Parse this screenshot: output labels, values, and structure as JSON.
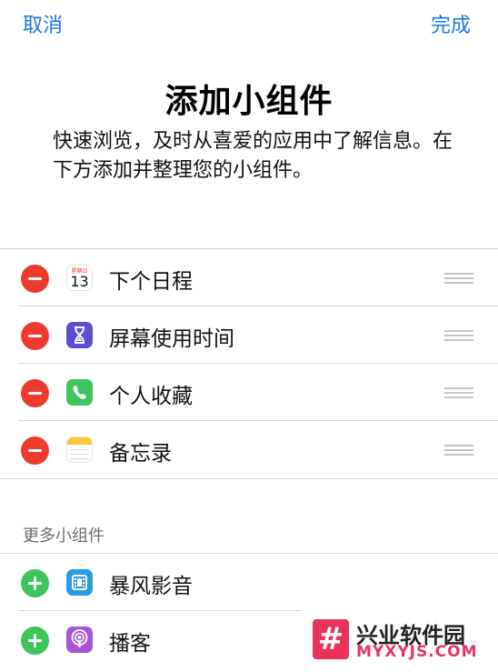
{
  "nav": {
    "cancel_label": "取消",
    "done_label": "完成"
  },
  "header": {
    "title": "添加小组件",
    "subtitle": "快速浏览，及时从喜爱的应用中了解信息。在下方添加并整理您的小组件。"
  },
  "active_widgets": [
    {
      "label": "下个日程",
      "icon": "calendar-icon",
      "calendar_weekday": "星期日",
      "calendar_day": "13"
    },
    {
      "label": "屏幕使用时间",
      "icon": "hourglass-icon"
    },
    {
      "label": "个人收藏",
      "icon": "phone-icon"
    },
    {
      "label": "备忘录",
      "icon": "notes-icon"
    }
  ],
  "more_section": {
    "header": "更多小组件",
    "items": [
      {
        "label": "暴风影音",
        "icon": "baofeng-icon"
      },
      {
        "label": "播客",
        "icon": "podcasts-icon"
      }
    ]
  },
  "watermark": {
    "logo_glyph": "#",
    "cn": "兴业软件园",
    "en": "MYXYJS.COM"
  },
  "colors": {
    "accent": "#1a78e0",
    "remove": "#f03a30",
    "add": "#3dc45a"
  }
}
